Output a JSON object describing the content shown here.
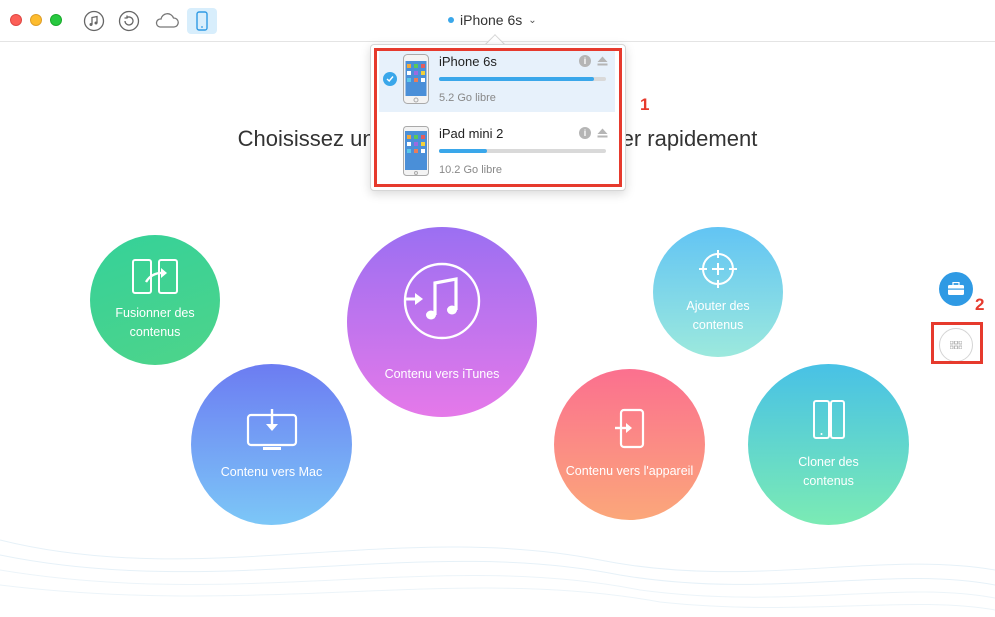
{
  "window": {
    "device_title": "iPhone 6s"
  },
  "toolbar": {
    "items": [
      {
        "icon": "music-note-icon"
      },
      {
        "icon": "restore-icon"
      },
      {
        "icon": "cloud-icon"
      },
      {
        "icon": "phone-icon",
        "active": true
      }
    ]
  },
  "main": {
    "headline": "Choisissez un raccourci pour commencer rapidement",
    "shortcuts": [
      {
        "label": "Fusionner des contenus"
      },
      {
        "label": "Contenu vers Mac"
      },
      {
        "label": "Contenu vers iTunes"
      },
      {
        "label": "Ajouter des contenus"
      },
      {
        "label": "Contenu vers l'appareil"
      },
      {
        "label": "Cloner des contenus"
      }
    ]
  },
  "device_menu": {
    "devices": [
      {
        "name": "iPhone 6s",
        "free": "5.2 Go libre",
        "used_fraction": 0.93,
        "selected": true
      },
      {
        "name": "iPad mini 2",
        "free": "10.2 Go libre",
        "used_fraction": 0.29,
        "selected": false
      }
    ]
  },
  "annotations": {
    "one": "1",
    "two": "2"
  },
  "colors": {
    "accent": "#3aa7ea",
    "annotation_red": "#e63a2d"
  }
}
